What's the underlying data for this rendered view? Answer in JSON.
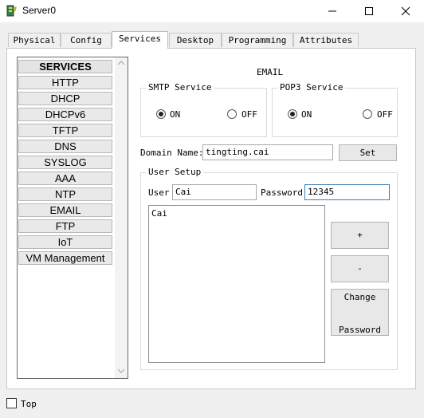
{
  "window": {
    "title": "Server0"
  },
  "tabs": [
    {
      "label": "Physical"
    },
    {
      "label": "Config"
    },
    {
      "label": "Services"
    },
    {
      "label": "Desktop"
    },
    {
      "label": "Programming"
    },
    {
      "label": "Attributes"
    }
  ],
  "active_tab": "Services",
  "services": {
    "header": "SERVICES",
    "items": [
      "HTTP",
      "DHCP",
      "DHCPv6",
      "TFTP",
      "DNS",
      "SYSLOG",
      "AAA",
      "NTP",
      "EMAIL",
      "FTP",
      "IoT",
      "VM Management"
    ]
  },
  "email": {
    "heading": "EMAIL",
    "smtp": {
      "title": "SMTP Service",
      "on_label": "ON",
      "off_label": "OFF",
      "selected": "ON"
    },
    "pop3": {
      "title": "POP3 Service",
      "on_label": "ON",
      "off_label": "OFF",
      "selected": "ON"
    },
    "domain_label": "Domain Name:",
    "domain_value": "tingting.cai",
    "set_label": "Set",
    "user_setup": {
      "title": "User Setup",
      "user_label": "User",
      "user_value": "Cai",
      "password_label": "Password",
      "password_value": "12345",
      "users": [
        "Cai"
      ],
      "add_label": "+",
      "remove_label": "-",
      "change_label_line1": "Change",
      "change_label_line2": "Password"
    }
  },
  "footer": {
    "top_label": "Top",
    "top_checked": false
  }
}
